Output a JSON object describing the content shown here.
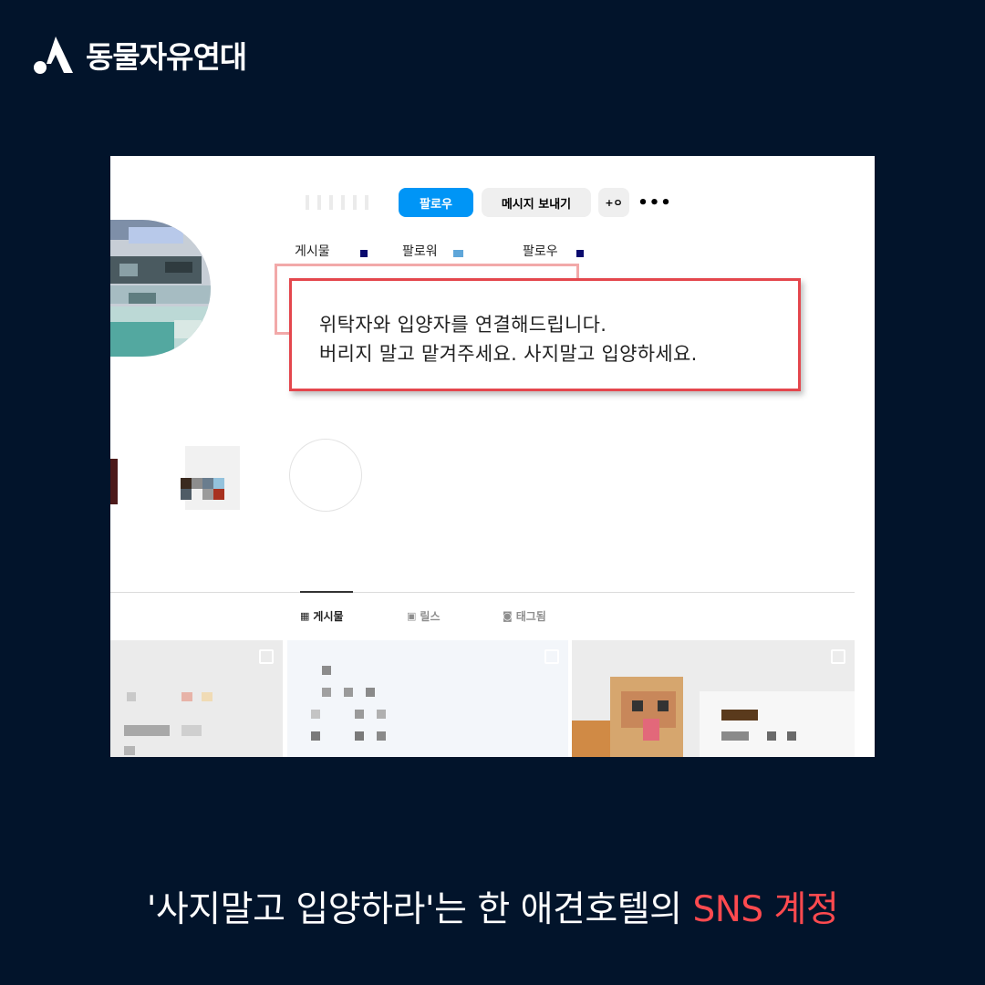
{
  "brand": {
    "name": "동물자유연대",
    "logo_icon": "org-logo-icon"
  },
  "profile": {
    "follow_label": "팔로우",
    "message_label": "메시지 보내기",
    "add_user_icon": "+ㅇ",
    "more_icon": "•••",
    "stats": {
      "posts": "게시물",
      "followers": "팔로워",
      "following": "팔로우"
    }
  },
  "callout": {
    "line1": "위탁자와 입양자를 연결해드립니다.",
    "line2": "버리지 말고 맡겨주세요. 사지말고 입양하세요."
  },
  "tabs": {
    "posts": "게시물",
    "reels": "릴스",
    "tagged": "태그됨"
  },
  "caption": {
    "main": "'사지말고 입양하라'는 한 애견호텔의 ",
    "accent": "SNS 계정"
  },
  "colors": {
    "background": "#02142b",
    "follow_button": "#0095f6",
    "callout_border": "#e4474d",
    "accent_text": "#ff4a4f"
  }
}
